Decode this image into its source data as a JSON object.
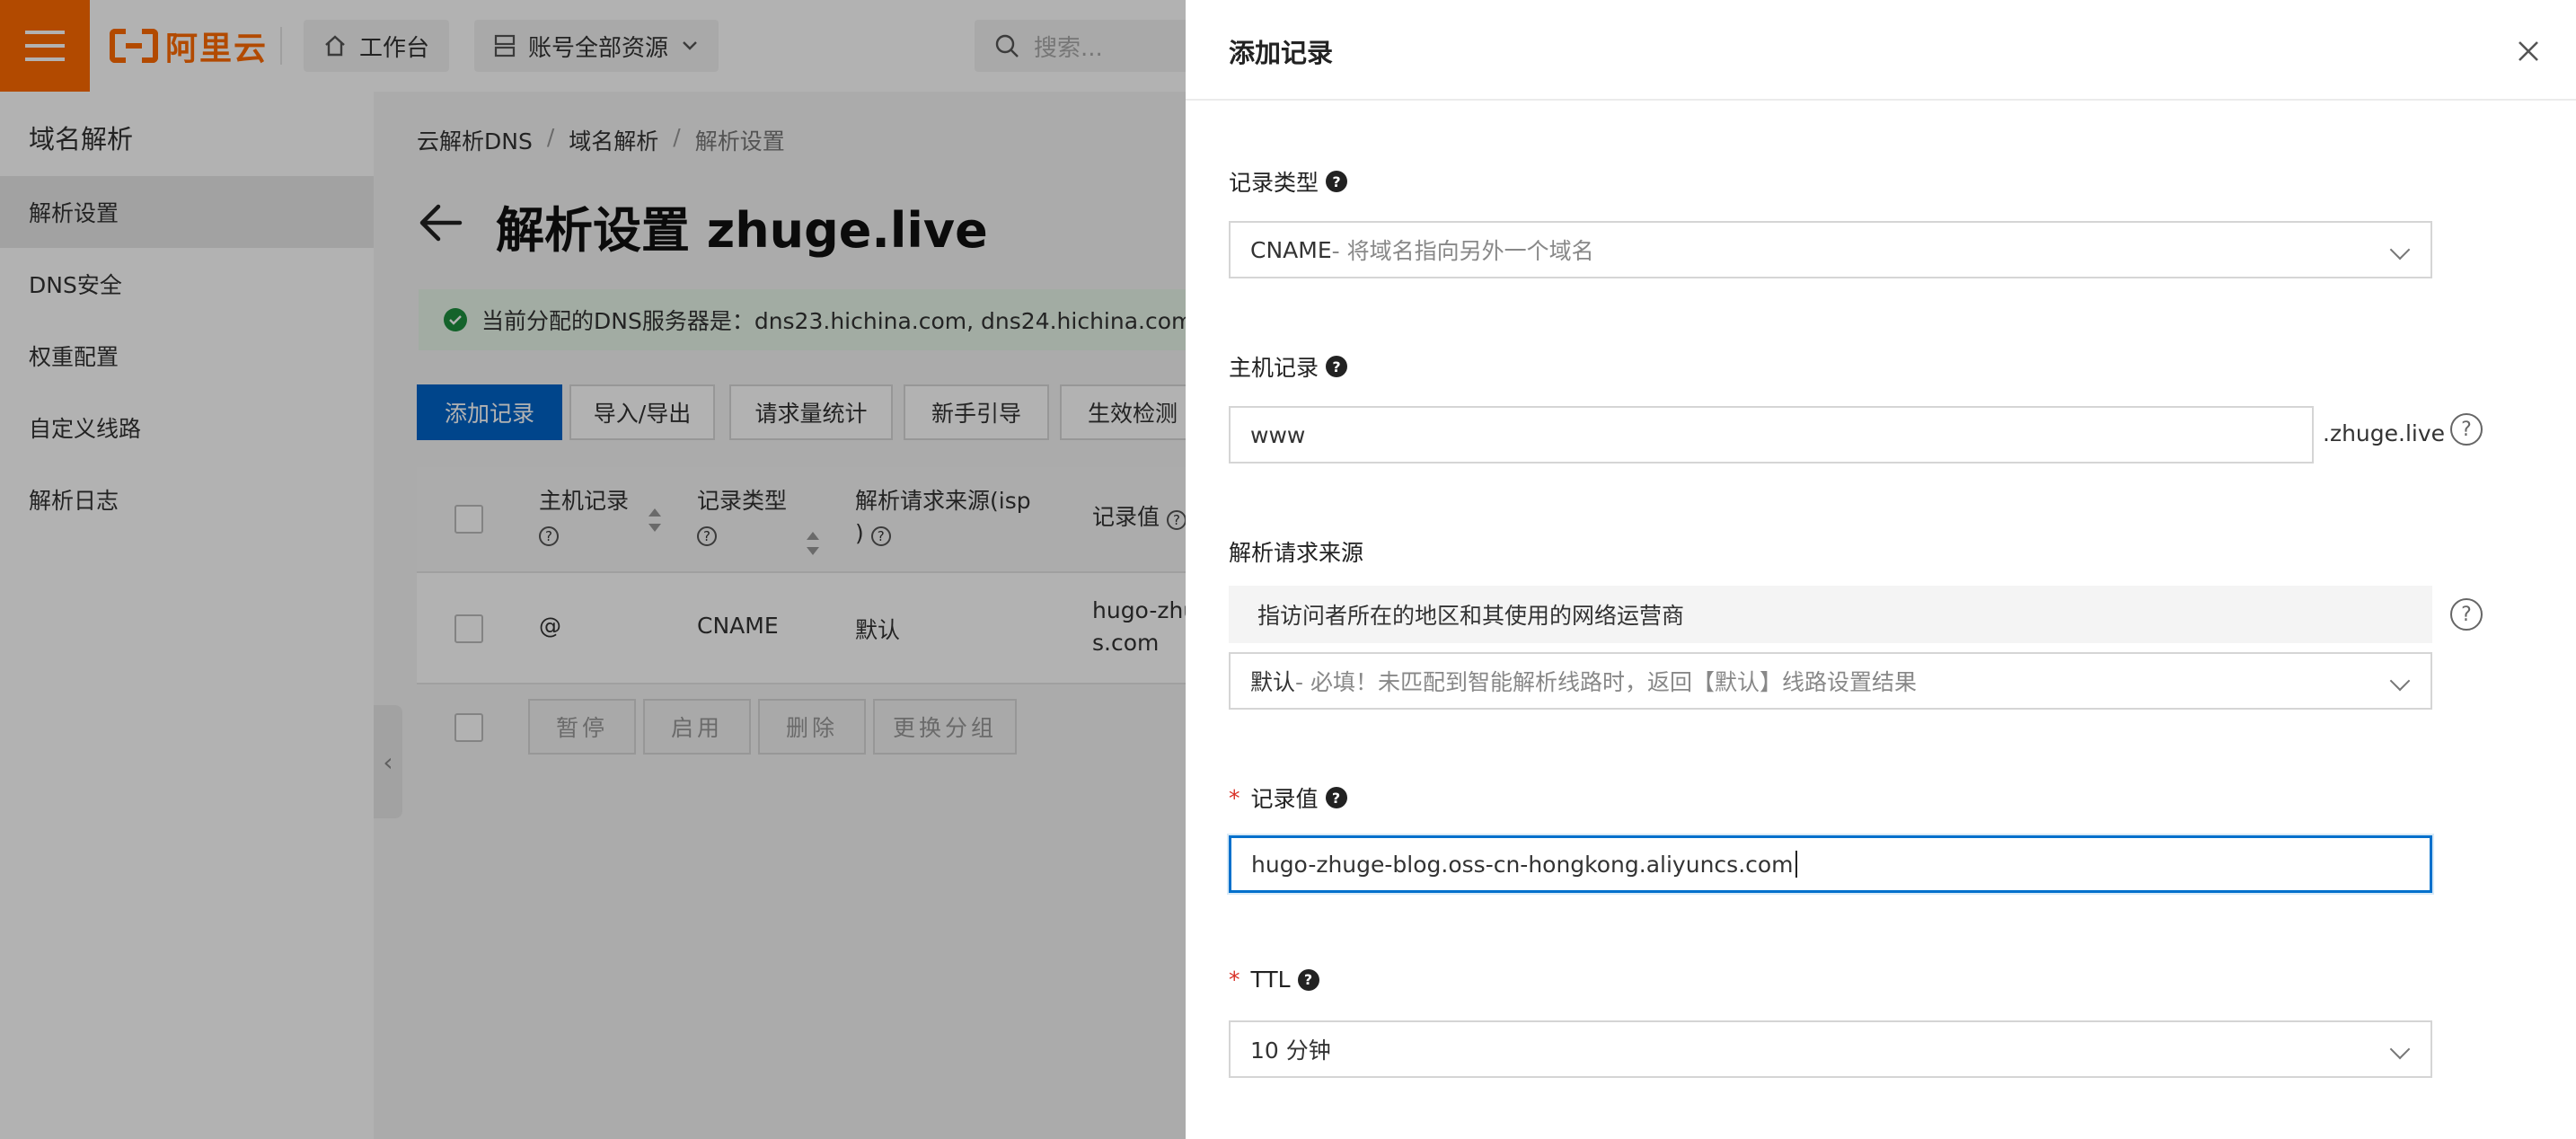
{
  "topbar": {
    "logo_text": "阿里云",
    "workbench_label": "工作台",
    "resources_label": "账号全部资源",
    "search_placeholder": "搜索..."
  },
  "sidebar": {
    "title": "域名解析",
    "items": [
      {
        "label": "解析设置",
        "active": true
      },
      {
        "label": "DNS安全"
      },
      {
        "label": "权重配置"
      },
      {
        "label": "自定义线路"
      },
      {
        "label": "解析日志"
      }
    ]
  },
  "breadcrumb": [
    "云解析DNS",
    "/",
    "域名解析",
    "/",
    "解析设置"
  ],
  "page": {
    "title": "解析设置 zhuge.live",
    "dns_notice": "当前分配的DNS服务器是：dns23.hichina.com, dns24.hichina.com"
  },
  "toolbar": {
    "add_record": "添加记录",
    "import_export": "导入/导出",
    "request_stats": "请求量统计",
    "beginner_guide": "新手引导",
    "effect_check": "生效检测"
  },
  "table": {
    "headers": [
      "主机记录",
      "记录类型",
      "解析请求来源(isp",
      ")",
      "记录值"
    ],
    "rows": [
      {
        "host": "@",
        "type": "CNAME",
        "line": "默认",
        "value_line1": "hugo-zhu",
        "value_line2": "s.com"
      }
    ],
    "batch": [
      "暂停",
      "启用",
      "删除",
      "更换分组"
    ]
  },
  "drawer": {
    "title": "添加记录",
    "record_type": {
      "label": "记录类型",
      "value": "CNAME",
      "desc": "- 将域名指向另外一个域名"
    },
    "host": {
      "label": "主机记录",
      "value": "www",
      "suffix": ".zhuge.live"
    },
    "line": {
      "label": "解析请求来源",
      "hint": "指访问者所在的地区和其使用的网络运营商",
      "value": "默认",
      "desc": " - 必填！未匹配到智能解析线路时，返回【默认】线路设置结果"
    },
    "record_value": {
      "required_mark": "*",
      "label": "记录值",
      "value": "hugo-zhuge-blog.oss-cn-hongkong.aliyuncs.com"
    },
    "ttl": {
      "required_mark": "*",
      "label": "TTL",
      "value": "10 分钟"
    }
  },
  "colors": {
    "brand": "#ff6a00",
    "primary": "#0064c8",
    "focus": "#0070cc",
    "required": "#d93026",
    "success": "#1e8e3e"
  }
}
